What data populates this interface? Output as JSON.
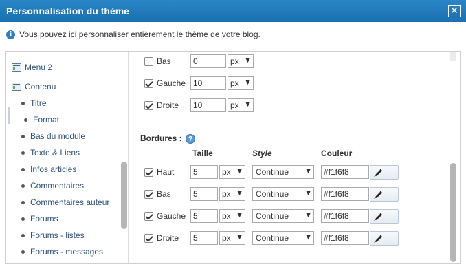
{
  "dialog": {
    "title": "Personnalisation du thème",
    "close_symbol": "✕",
    "info_text": "Vous pouvez ici personnaliser entièrement le thème de votre blog."
  },
  "sidebar": {
    "items": [
      {
        "label": "Menu 2",
        "type": "section",
        "icon": "module-icon"
      },
      {
        "label": "Contenu",
        "type": "section",
        "icon": "module-icon"
      },
      {
        "label": "Titre",
        "type": "sub"
      },
      {
        "label": "Format",
        "type": "sub",
        "active": true
      },
      {
        "label": "Bas du module",
        "type": "sub"
      },
      {
        "label": "Texte & Liens",
        "type": "sub"
      },
      {
        "label": "Infos articles",
        "type": "sub"
      },
      {
        "label": "Commentaires",
        "type": "sub"
      },
      {
        "label": "Commentaires auteur",
        "type": "sub"
      },
      {
        "label": "Forums",
        "type": "sub"
      },
      {
        "label": "Forums - listes",
        "type": "sub"
      },
      {
        "label": "Forums - messages",
        "type": "sub"
      }
    ]
  },
  "spacing_rows": [
    {
      "label": "Bas",
      "checked": false,
      "value": "0",
      "unit": "px"
    },
    {
      "label": "Gauche",
      "checked": true,
      "value": "10",
      "unit": "px"
    },
    {
      "label": "Droite",
      "checked": true,
      "value": "10",
      "unit": "px"
    }
  ],
  "borders": {
    "title": "Bordures :",
    "help_symbol": "?",
    "columns": {
      "size": "Taille",
      "style": "Style",
      "color": "Couleur"
    },
    "rows": [
      {
        "label": "Haut",
        "checked": true,
        "size": "5",
        "unit": "px",
        "style": "Continue",
        "color": "#f1f6f8"
      },
      {
        "label": "Bas",
        "checked": true,
        "size": "5",
        "unit": "px",
        "style": "Continue",
        "color": "#f1f6f8"
      },
      {
        "label": "Gauche",
        "checked": true,
        "size": "5",
        "unit": "px",
        "style": "Continue",
        "color": "#f1f6f8"
      },
      {
        "label": "Droite",
        "checked": true,
        "size": "5",
        "unit": "px",
        "style": "Continue",
        "color": "#f1f6f8"
      }
    ]
  },
  "arrow_symbol": "▼",
  "colors": {
    "titlebar": "#1a6fb0",
    "link": "#31527a"
  }
}
